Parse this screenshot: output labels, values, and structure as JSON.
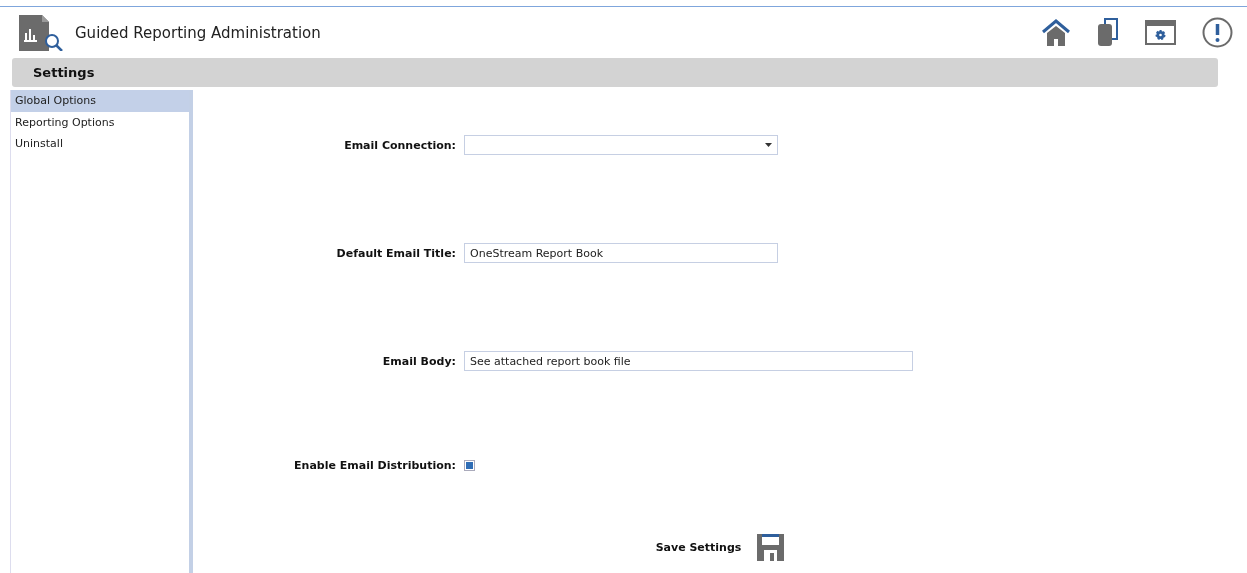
{
  "app": {
    "title": "Guided Reporting Administration"
  },
  "section": {
    "title": "Settings"
  },
  "sidebar": {
    "items": [
      {
        "label": "Global Options",
        "selected": true
      },
      {
        "label": "Reporting Options",
        "selected": false
      },
      {
        "label": "Uninstall",
        "selected": false
      }
    ]
  },
  "fields": [
    {
      "kind": "dropdown",
      "label": "Email Connection:"
    },
    {
      "kind": "text",
      "label": "Default Email Title:",
      "value": "OneStream Report Book"
    },
    {
      "kind": "wide-text",
      "label": "Email Body:",
      "value": "See attached report book file"
    },
    {
      "kind": "checkbox",
      "label": "Enable Email Distribution:",
      "checked": true
    }
  ],
  "save_button": {
    "label": "Save Settings"
  }
}
